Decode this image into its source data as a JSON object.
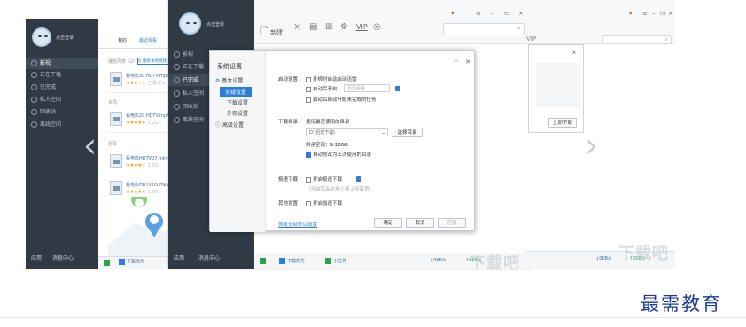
{
  "left_window": {
    "username": "点击登录",
    "nav": [
      "影视",
      "正在下载",
      "已完成",
      "私人空间",
      "回收站",
      "离线空间"
    ],
    "tabs": [
      "我的",
      "最近观看"
    ],
    "search_hint": "Q 搜索本地视频",
    "groups": [
      "播放列表（2）",
      "本周",
      "更早"
    ],
    "files": [
      {
        "name": "看电影30.HDTV.mp4",
        "rating": "★★★☆☆",
        "extra": "已看 1%"
      },
      {
        "name": "看电影29.HDTV.mp4",
        "rating": "★★★★★",
        "extra": "1.2G"
      },
      {
        "name": "看电影HDTV07.mkv",
        "rating": "★★★★☆",
        "extra": "1.1G"
      },
      {
        "name": "看电影HDTV.05.mkv",
        "rating": "★★★★★",
        "extra": "1.6G"
      }
    ],
    "bottom": [
      "应用",
      "消息中心"
    ],
    "status": "下载优先"
  },
  "main_window": {
    "username": "点击登录",
    "nav": [
      "影视",
      "正在下载",
      "已完成",
      "私人空间",
      "回收站",
      "离线空间"
    ],
    "toolbar": {
      "new": "新建",
      "vip": "VIP"
    },
    "window_controls": [
      "▾",
      "≡",
      "–",
      "▭",
      "×"
    ],
    "bottom": [
      "应用",
      "消息中心"
    ],
    "status": {
      "priority": "下载优先",
      "tasks": "小任务",
      "down_speed": "0KB/s",
      "up_speed": "0KB/s"
    }
  },
  "dialog": {
    "title": "系统设置",
    "nav": {
      "basic": "基本设置",
      "sub": [
        "常规设置",
        "下载设置",
        "外观设置"
      ],
      "advanced": "高级设置"
    },
    "startup": {
      "label": "启动设置：",
      "opt1": "开机时自动启动迅雷",
      "opt2": "启动后开启",
      "opt2_value": "迅雷看看",
      "opt3": "启动后自动开始未完成的任务"
    },
    "download_dir": {
      "label": "下载目录：",
      "opt1": "使用最近使用的目录",
      "path": "D:\\迅雷下载\\",
      "choose": "选择目录",
      "free": "剩余空间：9.18GB",
      "opt2": "自动修改为上次使用的目录"
    },
    "lightspeed": {
      "label": "极速下载：",
      "opt1": "开启极速下载",
      "hint": "（开启后会占用少量上传带宽）"
    },
    "free_task": {
      "label": "其他设置：",
      "opt1": "开启加速下载"
    },
    "restore_link": "恢复全部默认设置",
    "buttons": {
      "ok": "确定",
      "cancel": "取消",
      "apply": "应用"
    }
  },
  "right_window": {
    "vip": "VIP",
    "sub_button": "立即下载",
    "status": {
      "down_speed": "0KB/s",
      "up_speed": "0KB/s"
    }
  },
  "watermark": "下载吧",
  "brand": "最需教育",
  "colors": {
    "sidebar": "#2f3a44",
    "accent": "#2b7fd6",
    "brand": "#1b3a9b",
    "star": "#f5a51d"
  }
}
